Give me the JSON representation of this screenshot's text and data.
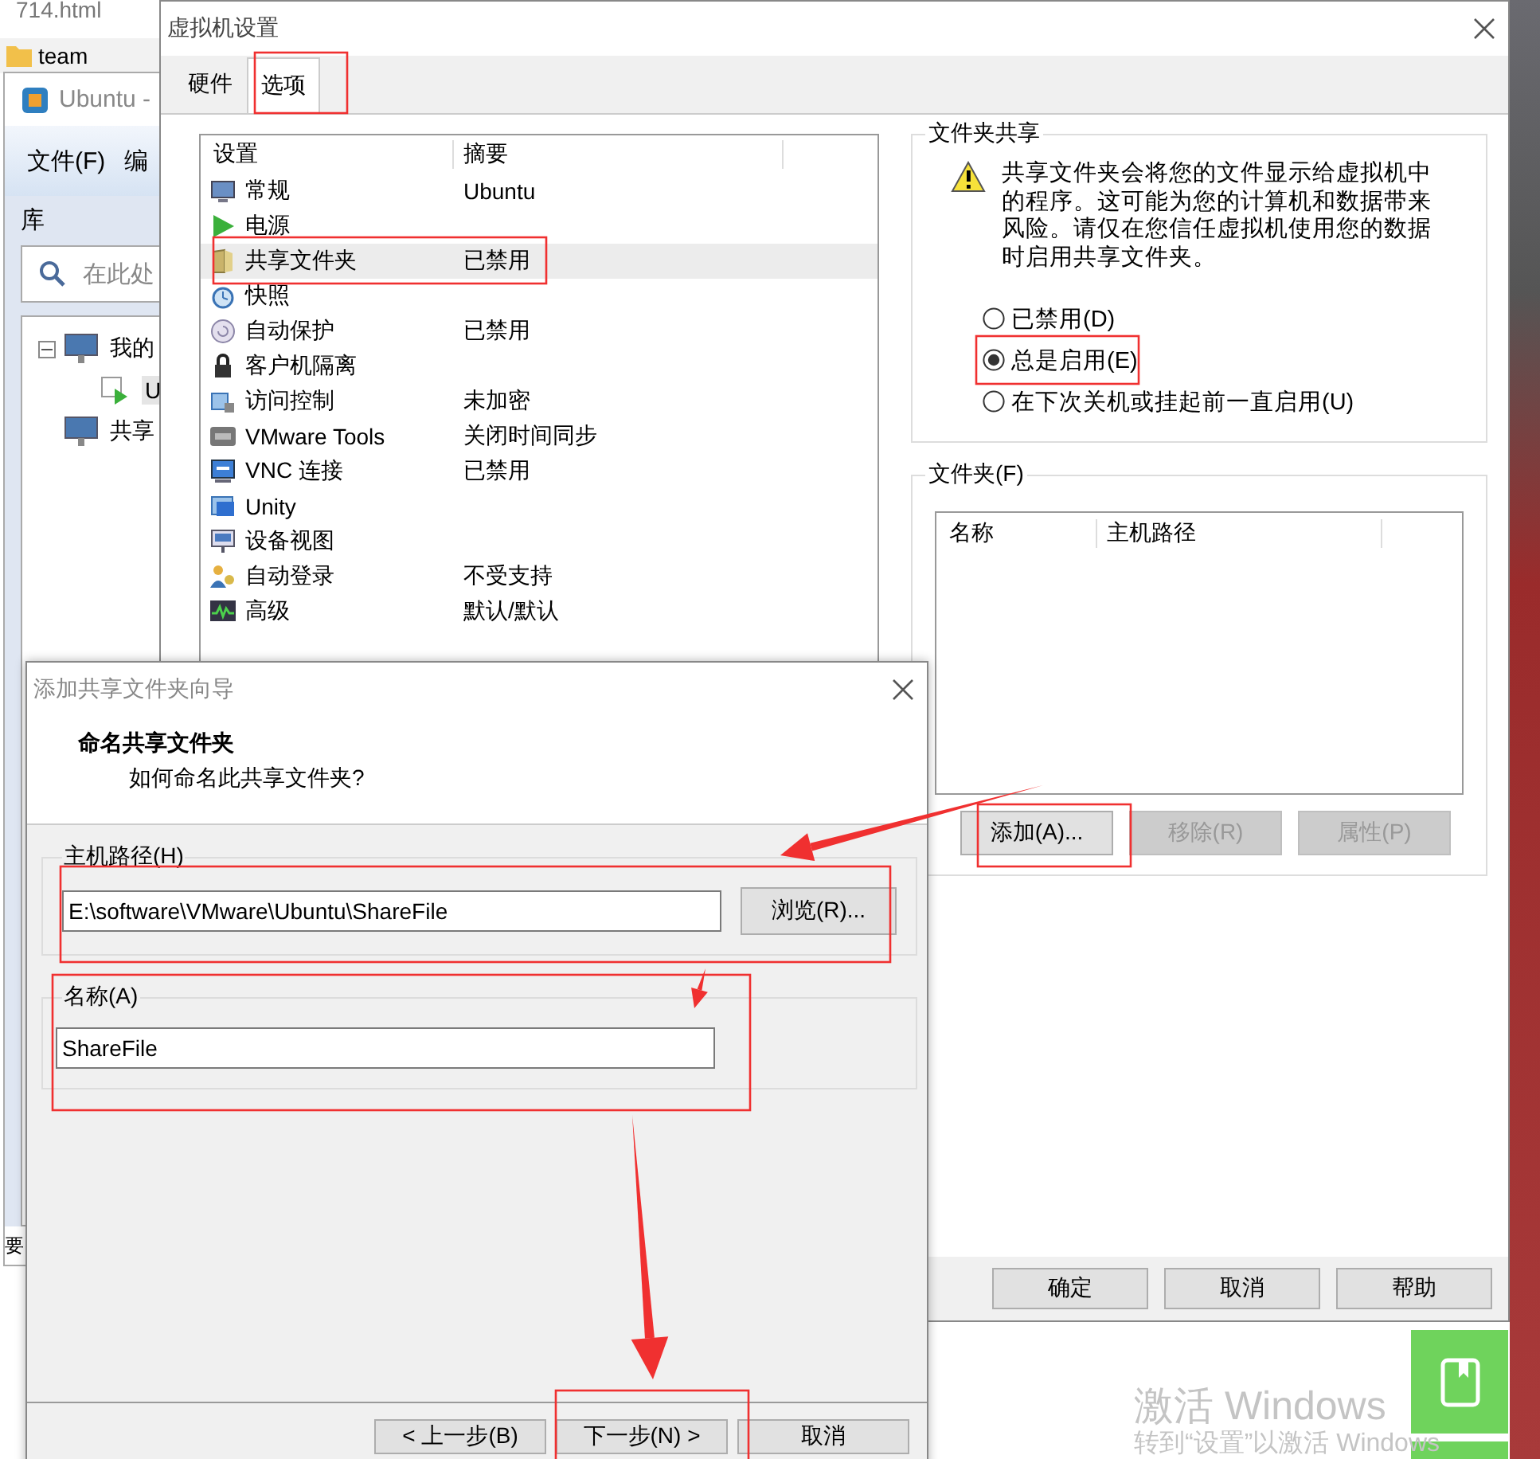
{
  "browser_tab": {
    "title": "714.html"
  },
  "ubuntu_window": {
    "folder_tab": "team",
    "title": "Ubuntu -",
    "menu": [
      "文件(F)",
      "编"
    ],
    "library_label": "库",
    "search": {
      "placeholder": "在此处"
    },
    "tree": [
      {
        "label": "我的",
        "expanded": true,
        "children": [
          {
            "label": "U",
            "selected": true
          }
        ]
      },
      {
        "label": "共享",
        "selected": false
      }
    ],
    "status": "要"
  },
  "settings_dialog": {
    "title": "虚拟机设置",
    "tabs": [
      {
        "label": "硬件",
        "selected": false
      },
      {
        "label": "选项",
        "selected": true
      }
    ],
    "list": {
      "columns": [
        "设置",
        "摘要"
      ],
      "rows": [
        {
          "name": "常规",
          "summary": "Ubuntu",
          "selected": false
        },
        {
          "name": "电源",
          "selected": false
        },
        {
          "name": "共享文件夹",
          "summary": "已禁用",
          "selected": true
        },
        {
          "name": "快照",
          "selected": false
        },
        {
          "name": "自动保护",
          "summary": "已禁用",
          "selected": false
        },
        {
          "name": "客户机隔离",
          "selected": false
        },
        {
          "name": "访问控制",
          "summary": "未加密",
          "selected": false
        },
        {
          "name": "VMware Tools",
          "summary": "关闭时间同步",
          "selected": false
        },
        {
          "name": "VNC 连接",
          "summary": "已禁用",
          "selected": false
        },
        {
          "name": "Unity",
          "selected": false
        },
        {
          "name": "设备视图",
          "selected": false
        },
        {
          "name": "自动登录",
          "summary": "不受支持",
          "selected": false
        },
        {
          "name": "高级",
          "summary": "默认/默认",
          "selected": false
        }
      ]
    },
    "folder_sharing": {
      "title": "文件夹共享",
      "warning": "共享文件夹会将您的文件显示给虚拟机中的程序。这可能为您的计算机和数据带来风险。请仅在您信任虚拟机使用您的数据时启用共享文件夹。",
      "options": [
        {
          "label": "已禁用(D)",
          "selected": false
        },
        {
          "label": "总是启用(E)",
          "selected": true
        },
        {
          "label": "在下次关机或挂起前一直启用(U)",
          "selected": false
        }
      ]
    },
    "folders": {
      "title": "文件夹(F)",
      "columns": [
        "名称",
        "主机路径"
      ],
      "buttons": [
        {
          "label": "添加(A)...",
          "disabled": false
        },
        {
          "label": "移除(R)",
          "disabled": true
        },
        {
          "label": "属性(P)",
          "disabled": true
        }
      ]
    },
    "buttons": [
      "确定",
      "取消",
      "帮助"
    ]
  },
  "wizard": {
    "title": "添加共享文件夹向导",
    "heading": "命名共享文件夹",
    "subheading": "如何命名此共享文件夹?",
    "host_path": {
      "label": "主机路径(H)",
      "value": "E:\\software\\VMware\\Ubuntu\\ShareFile",
      "browse": "浏览(R)..."
    },
    "name": {
      "label": "名称(A)",
      "value": "ShareFile"
    },
    "buttons": [
      "< 上一步(B)",
      "下一步(N) >",
      "取消"
    ]
  },
  "watermark": {
    "title": "激活 Windows",
    "subtitle": "转到“设置”以激活 Windows"
  }
}
